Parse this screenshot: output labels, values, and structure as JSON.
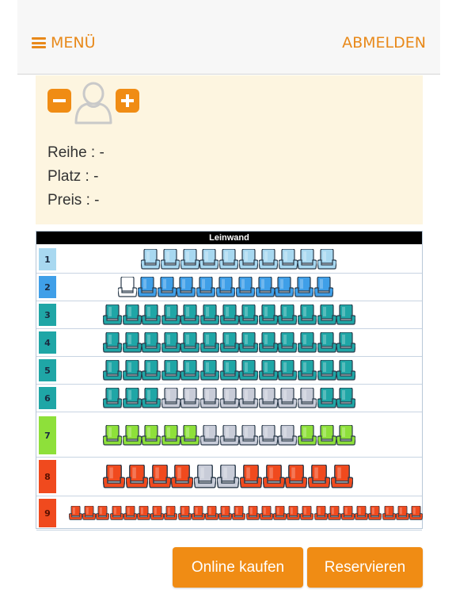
{
  "header": {
    "menu_label": "MENÜ",
    "logout_label": "ABMELDEN"
  },
  "info": {
    "row_text": "Reihe : -",
    "seat_text": "Platz  : -",
    "price_text": "Preis  : -"
  },
  "seatmap": {
    "screen_label": "Leinwand",
    "rows": [
      {
        "label": "1",
        "label_color": "#a8d8f0",
        "seats": [
          "free",
          "free",
          "free",
          "free",
          "free",
          "free",
          "free",
          "free",
          "free",
          "free"
        ]
      },
      {
        "label": "2",
        "label_color": "#3f9fe8",
        "seats": [
          "empty",
          "free",
          "free",
          "free",
          "free",
          "free",
          "free",
          "free",
          "free",
          "free",
          "free"
        ]
      },
      {
        "label": "3",
        "label_color": "#1fa6a6",
        "seats": [
          "free",
          "free",
          "free",
          "free",
          "free",
          "free",
          "free",
          "free",
          "free",
          "free",
          "free",
          "free",
          "free"
        ]
      },
      {
        "label": "4",
        "label_color": "#1fa6a6",
        "seats": [
          "free",
          "free",
          "free",
          "free",
          "free",
          "free",
          "free",
          "free",
          "free",
          "free",
          "free",
          "free",
          "free"
        ]
      },
      {
        "label": "5",
        "label_color": "#1fa6a6",
        "seats": [
          "free",
          "free",
          "free",
          "free",
          "free",
          "free",
          "free",
          "free",
          "free",
          "free",
          "free",
          "free",
          "free"
        ]
      },
      {
        "label": "6",
        "label_color": "#1fa6a6",
        "seats": [
          "free",
          "free",
          "free",
          "taken",
          "taken",
          "taken",
          "taken",
          "taken",
          "taken",
          "taken",
          "taken",
          "free",
          "free"
        ]
      },
      {
        "label": "7",
        "label_color": "#8ee03a",
        "seats": [
          "free",
          "free",
          "free",
          "free",
          "free",
          "taken",
          "taken",
          "taken",
          "taken",
          "taken",
          "free",
          "free",
          "free"
        ]
      },
      {
        "label": "8",
        "label_color": "#f04a1e",
        "seats": [
          "free",
          "free",
          "free",
          "free",
          "taken",
          "taken",
          "free",
          "free",
          "free",
          "free",
          "free"
        ]
      },
      {
        "label": "9",
        "label_color": "#f04a1e",
        "seats": [
          "free",
          "free",
          "free",
          "free",
          "free",
          "free",
          "free",
          "free",
          "free",
          "free",
          "free",
          "free",
          "free",
          "free",
          "free",
          "free",
          "free",
          "free",
          "free",
          "free",
          "free",
          "free",
          "free",
          "free",
          "free",
          "free"
        ]
      }
    ],
    "colors": {
      "row1": "#a8d8f0",
      "row2": "#3f9fe8",
      "teal": "#1fa6a6",
      "green": "#8ee03a",
      "red": "#f04a1e",
      "taken": "#c8ccd8",
      "empty": "#ffffff"
    }
  },
  "actions": {
    "buy_label": "Online kaufen",
    "reserve_label": "Reservieren"
  },
  "icons": {
    "menu": "hamburger-icon",
    "minus": "minus-icon",
    "plus": "plus-icon",
    "person": "person-icon",
    "seat": "cinema-seat-icon"
  },
  "accent_color": "#f08c14"
}
